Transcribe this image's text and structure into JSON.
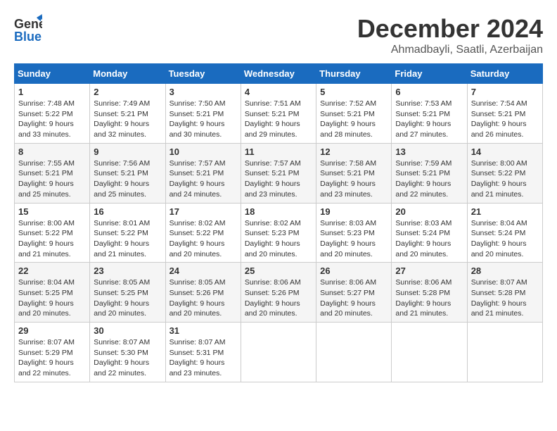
{
  "header": {
    "logo_general": "General",
    "logo_blue": "Blue",
    "month": "December 2024",
    "location": "Ahmadbayli, Saatli, Azerbaijan"
  },
  "weekdays": [
    "Sunday",
    "Monday",
    "Tuesday",
    "Wednesday",
    "Thursday",
    "Friday",
    "Saturday"
  ],
  "weeks": [
    [
      {
        "day": "1",
        "sunrise": "7:48 AM",
        "sunset": "5:22 PM",
        "daylight": "9 hours and 33 minutes."
      },
      {
        "day": "2",
        "sunrise": "7:49 AM",
        "sunset": "5:21 PM",
        "daylight": "9 hours and 32 minutes."
      },
      {
        "day": "3",
        "sunrise": "7:50 AM",
        "sunset": "5:21 PM",
        "daylight": "9 hours and 30 minutes."
      },
      {
        "day": "4",
        "sunrise": "7:51 AM",
        "sunset": "5:21 PM",
        "daylight": "9 hours and 29 minutes."
      },
      {
        "day": "5",
        "sunrise": "7:52 AM",
        "sunset": "5:21 PM",
        "daylight": "9 hours and 28 minutes."
      },
      {
        "day": "6",
        "sunrise": "7:53 AM",
        "sunset": "5:21 PM",
        "daylight": "9 hours and 27 minutes."
      },
      {
        "day": "7",
        "sunrise": "7:54 AM",
        "sunset": "5:21 PM",
        "daylight": "9 hours and 26 minutes."
      }
    ],
    [
      {
        "day": "8",
        "sunrise": "7:55 AM",
        "sunset": "5:21 PM",
        "daylight": "9 hours and 25 minutes."
      },
      {
        "day": "9",
        "sunrise": "7:56 AM",
        "sunset": "5:21 PM",
        "daylight": "9 hours and 25 minutes."
      },
      {
        "day": "10",
        "sunrise": "7:57 AM",
        "sunset": "5:21 PM",
        "daylight": "9 hours and 24 minutes."
      },
      {
        "day": "11",
        "sunrise": "7:57 AM",
        "sunset": "5:21 PM",
        "daylight": "9 hours and 23 minutes."
      },
      {
        "day": "12",
        "sunrise": "7:58 AM",
        "sunset": "5:21 PM",
        "daylight": "9 hours and 23 minutes."
      },
      {
        "day": "13",
        "sunrise": "7:59 AM",
        "sunset": "5:21 PM",
        "daylight": "9 hours and 22 minutes."
      },
      {
        "day": "14",
        "sunrise": "8:00 AM",
        "sunset": "5:22 PM",
        "daylight": "9 hours and 21 minutes."
      }
    ],
    [
      {
        "day": "15",
        "sunrise": "8:00 AM",
        "sunset": "5:22 PM",
        "daylight": "9 hours and 21 minutes."
      },
      {
        "day": "16",
        "sunrise": "8:01 AM",
        "sunset": "5:22 PM",
        "daylight": "9 hours and 21 minutes."
      },
      {
        "day": "17",
        "sunrise": "8:02 AM",
        "sunset": "5:22 PM",
        "daylight": "9 hours and 20 minutes."
      },
      {
        "day": "18",
        "sunrise": "8:02 AM",
        "sunset": "5:23 PM",
        "daylight": "9 hours and 20 minutes."
      },
      {
        "day": "19",
        "sunrise": "8:03 AM",
        "sunset": "5:23 PM",
        "daylight": "9 hours and 20 minutes."
      },
      {
        "day": "20",
        "sunrise": "8:03 AM",
        "sunset": "5:24 PM",
        "daylight": "9 hours and 20 minutes."
      },
      {
        "day": "21",
        "sunrise": "8:04 AM",
        "sunset": "5:24 PM",
        "daylight": "9 hours and 20 minutes."
      }
    ],
    [
      {
        "day": "22",
        "sunrise": "8:04 AM",
        "sunset": "5:25 PM",
        "daylight": "9 hours and 20 minutes."
      },
      {
        "day": "23",
        "sunrise": "8:05 AM",
        "sunset": "5:25 PM",
        "daylight": "9 hours and 20 minutes."
      },
      {
        "day": "24",
        "sunrise": "8:05 AM",
        "sunset": "5:26 PM",
        "daylight": "9 hours and 20 minutes."
      },
      {
        "day": "25",
        "sunrise": "8:06 AM",
        "sunset": "5:26 PM",
        "daylight": "9 hours and 20 minutes."
      },
      {
        "day": "26",
        "sunrise": "8:06 AM",
        "sunset": "5:27 PM",
        "daylight": "9 hours and 20 minutes."
      },
      {
        "day": "27",
        "sunrise": "8:06 AM",
        "sunset": "5:28 PM",
        "daylight": "9 hours and 21 minutes."
      },
      {
        "day": "28",
        "sunrise": "8:07 AM",
        "sunset": "5:28 PM",
        "daylight": "9 hours and 21 minutes."
      }
    ],
    [
      {
        "day": "29",
        "sunrise": "8:07 AM",
        "sunset": "5:29 PM",
        "daylight": "9 hours and 22 minutes."
      },
      {
        "day": "30",
        "sunrise": "8:07 AM",
        "sunset": "5:30 PM",
        "daylight": "9 hours and 22 minutes."
      },
      {
        "day": "31",
        "sunrise": "8:07 AM",
        "sunset": "5:31 PM",
        "daylight": "9 hours and 23 minutes."
      },
      null,
      null,
      null,
      null
    ]
  ],
  "labels": {
    "sunrise": "Sunrise:",
    "sunset": "Sunset:",
    "daylight": "Daylight:"
  }
}
